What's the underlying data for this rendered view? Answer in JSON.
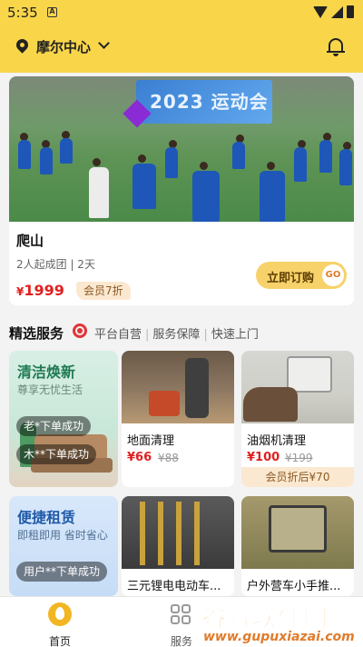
{
  "status_bar": {
    "time": "5:35",
    "notif_icon": "a-notification-icon"
  },
  "location": {
    "name": "摩尔中心"
  },
  "featured": {
    "banner_text": "2023 运动会",
    "title": "爬山",
    "meta": "2人起成团 | 2天",
    "price": "1999",
    "currency": "¥",
    "member_badge": "会员7折",
    "order_label": "立即订购",
    "go_label": "GO"
  },
  "section": {
    "title": "精选服务",
    "tags": [
      "平台自营",
      "服务保障",
      "快速上门"
    ]
  },
  "promo_tiles": [
    {
      "title": "清洁焕新",
      "subtitle": "尊享无忧生活",
      "pills": [
        "老*下单成功",
        "木**下单成功"
      ]
    },
    {
      "title": "便捷租赁",
      "subtitle": "即租即用 省时省心",
      "pills": [
        "用户**下单成功"
      ]
    }
  ],
  "services": [
    {
      "name": "地面清理",
      "price": "¥66",
      "old_price": "¥88"
    },
    {
      "name": "油烟机清理",
      "price": "¥100",
      "old_price": "¥199",
      "member": "会员折后¥70"
    },
    {
      "name": "三元锂电电动车...",
      "price": "",
      "old_price": ""
    },
    {
      "name": "户外营车小手推...",
      "price": "",
      "old_price": ""
    }
  ],
  "bottom_nav": {
    "home": "首页",
    "service": "服务"
  },
  "watermark": {
    "main": "谷普软件园",
    "url": "www.gupuxiazai.com"
  },
  "colors": {
    "accent": "#f9d54a",
    "price_red": "#e02020",
    "member_bg": "#fbe8d0"
  }
}
